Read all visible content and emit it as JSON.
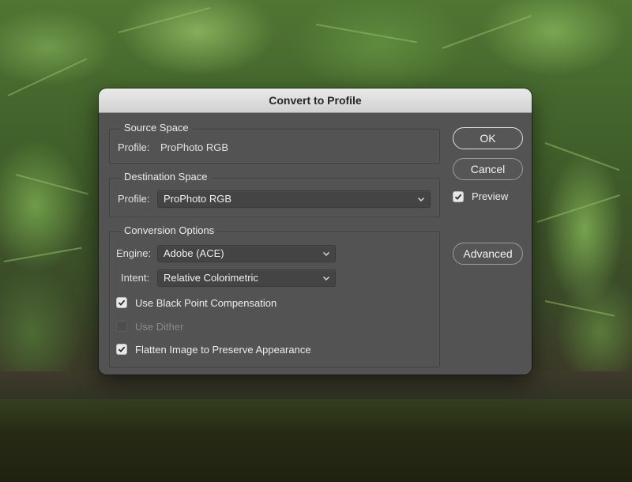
{
  "dialog": {
    "title": "Convert to Profile",
    "source_space": {
      "legend": "Source Space",
      "profile_label": "Profile:",
      "profile_value": "ProPhoto RGB"
    },
    "destination_space": {
      "legend": "Destination Space",
      "profile_label": "Profile:",
      "profile_value": "ProPhoto RGB"
    },
    "conversion_options": {
      "legend": "Conversion Options",
      "engine_label": "Engine:",
      "engine_value": "Adobe (ACE)",
      "intent_label": "Intent:",
      "intent_value": "Relative Colorimetric",
      "checkboxes": [
        {
          "label": "Use Black Point Compensation",
          "checked": true,
          "enabled": true
        },
        {
          "label": "Use Dither",
          "checked": false,
          "enabled": false
        },
        {
          "label": "Flatten Image to Preserve Appearance",
          "checked": true,
          "enabled": true
        }
      ]
    },
    "buttons": {
      "ok": "OK",
      "cancel": "Cancel",
      "advanced": "Advanced"
    },
    "preview": {
      "label": "Preview",
      "checked": true
    }
  },
  "icons": {
    "checkmark": "checkmark-icon",
    "dropdown": "chevron-down-icon"
  },
  "colors": {
    "dialog_bg": "#535353",
    "titlebar": "#dcdcdc",
    "text": "#e6e6e6"
  }
}
